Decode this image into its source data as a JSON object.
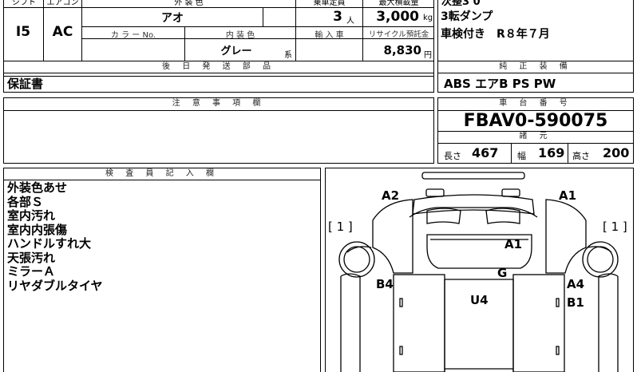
{
  "top_left": {
    "col_headers": [
      "シフト",
      "エアコン",
      "外 装 色",
      "乗車定員",
      "最大積載量"
    ],
    "shift": "I5",
    "aircon": "AC",
    "ext_color": "アオ",
    "capacity": "3",
    "capacity_unit": "人",
    "max_load": "3,000",
    "max_load_unit": "kg",
    "sub_headers": [
      "カ ラ ー No.",
      "内 装 色",
      "輸 入 車",
      "リサイクル預託金"
    ],
    "int_color": "グレー",
    "int_color_suffix": "系",
    "recycle_fee": "8,830",
    "recycle_unit": "円",
    "later_parts_header": "後 日 発 送 部 品",
    "later_parts": "保証書"
  },
  "top_right": {
    "line0": "次整3 0",
    "line1": "3転ダンプ",
    "line2": "車検付き　R８年７月",
    "equipment_header": "純 正 装 備",
    "equipment": "ABS エアB PS PW"
  },
  "notes_section": {
    "header": "注 意 事 項 欄",
    "text": ""
  },
  "chassis": {
    "header": "車 台 番 号",
    "number": "FBAV0-590075",
    "dims_header": "諸 元",
    "length_label": "長さ",
    "length": "467",
    "width_label": "幅",
    "width": "169",
    "height_label": "高さ",
    "height": "200"
  },
  "inspector": {
    "header": "検 査 員 記 入 欄",
    "lines": [
      "外装色あせ",
      "各部Ｓ",
      "室内汚れ",
      "室内内張傷",
      "ハンドルすれ大",
      "天張汚れ",
      "ミラーＡ",
      "リヤダブルタイヤ"
    ]
  },
  "diagram": {
    "marks": {
      "a2": "A2",
      "a1_top": "A1",
      "a1_mid": "A1",
      "g": "G",
      "b4": "B4",
      "u4": "U4",
      "a4": "A4",
      "b1": "B1",
      "left_bracket": "[ 1 ]",
      "right_bracket": "[ 1 ]"
    }
  }
}
